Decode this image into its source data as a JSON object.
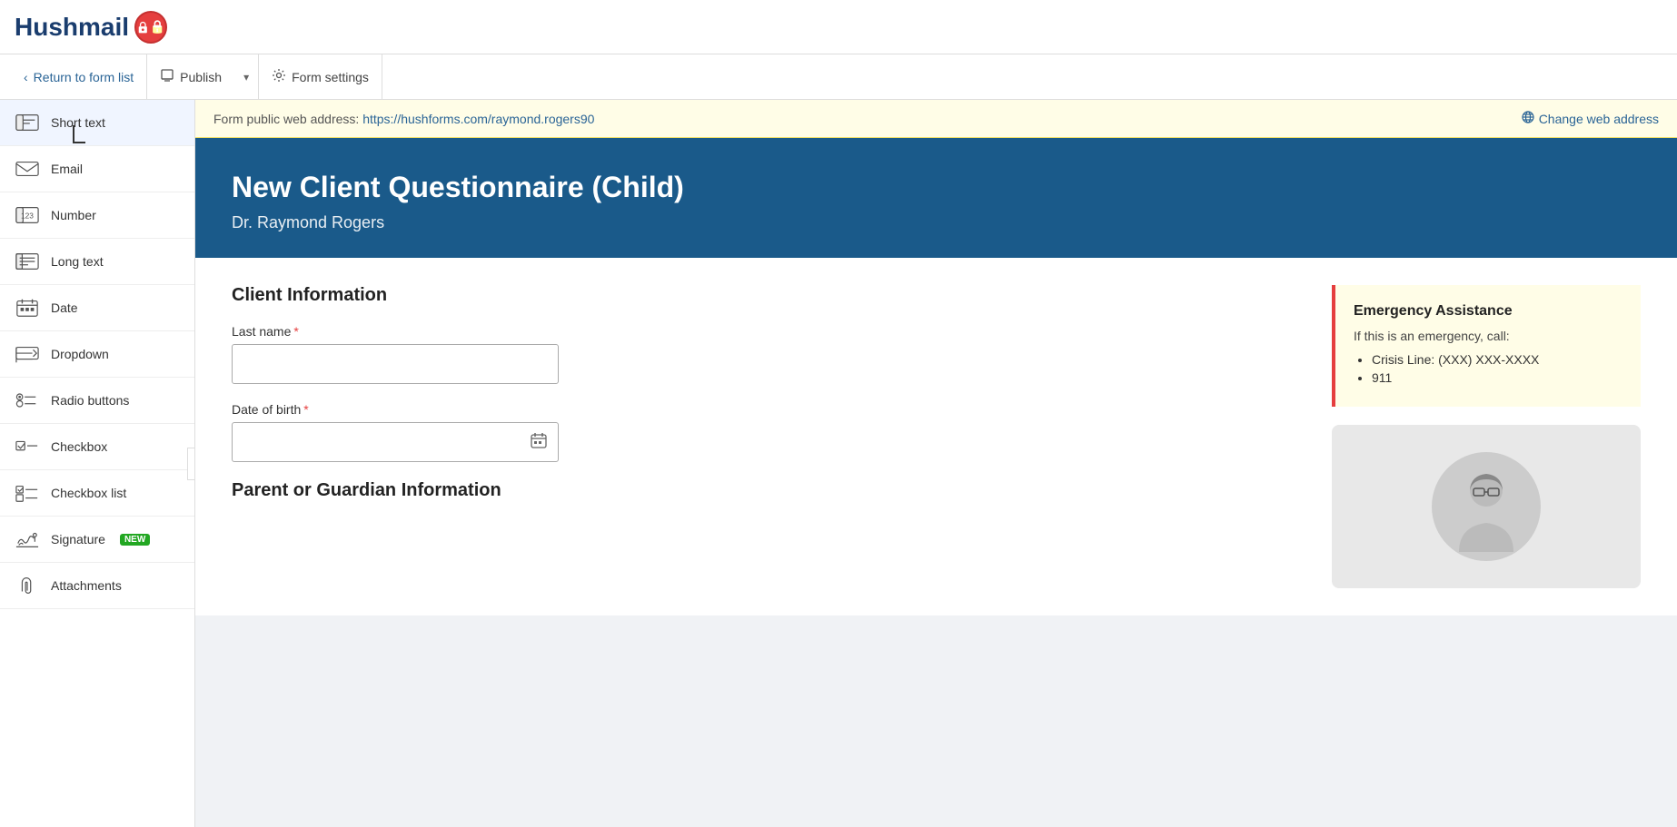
{
  "header": {
    "logo_text": "Hushmail",
    "logo_icon": "lock-icon"
  },
  "toolbar": {
    "return_label": "Return to form list",
    "publish_label": "Publish",
    "form_settings_label": "Form settings",
    "return_arrow": "‹",
    "dropdown_arrow": "▾",
    "settings_icon": "⚙"
  },
  "sidebar": {
    "toggle_icon": "‹",
    "items": [
      {
        "id": "short-text",
        "label": "Short text",
        "icon": "short-text-icon"
      },
      {
        "id": "email",
        "label": "Email",
        "icon": "email-icon"
      },
      {
        "id": "number",
        "label": "Number",
        "icon": "number-icon"
      },
      {
        "id": "long-text",
        "label": "Long text",
        "icon": "long-text-icon"
      },
      {
        "id": "date",
        "label": "Date",
        "icon": "date-icon"
      },
      {
        "id": "dropdown",
        "label": "Dropdown",
        "icon": "dropdown-icon"
      },
      {
        "id": "radio-buttons",
        "label": "Radio buttons",
        "icon": "radio-icon"
      },
      {
        "id": "checkbox",
        "label": "Checkbox",
        "icon": "checkbox-icon"
      },
      {
        "id": "checkbox-list",
        "label": "Checkbox list",
        "icon": "checkbox-list-icon"
      },
      {
        "id": "signature",
        "label": "Signature",
        "badge": "NEW",
        "icon": "signature-icon"
      },
      {
        "id": "attachments",
        "label": "Attachments",
        "icon": "attachments-icon"
      }
    ]
  },
  "address_bar": {
    "label": "Form public web address:",
    "url": "https://hushforms.com/raymond.rogers90",
    "change_label": "Change web address",
    "globe_icon": "globe-icon"
  },
  "form": {
    "title": "New Client Questionnaire (Child)",
    "subtitle": "Dr. Raymond Rogers",
    "header_bg": "#1a5a8a",
    "sections": [
      {
        "id": "client-info",
        "title": "Client Information",
        "fields": [
          {
            "id": "last-name",
            "label": "Last name",
            "required": true,
            "type": "text"
          },
          {
            "id": "dob",
            "label": "Date of birth",
            "required": true,
            "type": "date"
          }
        ]
      },
      {
        "id": "guardian-info",
        "title": "Parent or Guardian Information",
        "fields": []
      }
    ],
    "sidebar": {
      "emergency": {
        "title": "Emergency Assistance",
        "subtitle": "If this is an emergency, call:",
        "items": [
          "Crisis Line: (XXX) XXX-XXXX",
          "911"
        ]
      },
      "photo_alt": "Doctor photo"
    }
  }
}
